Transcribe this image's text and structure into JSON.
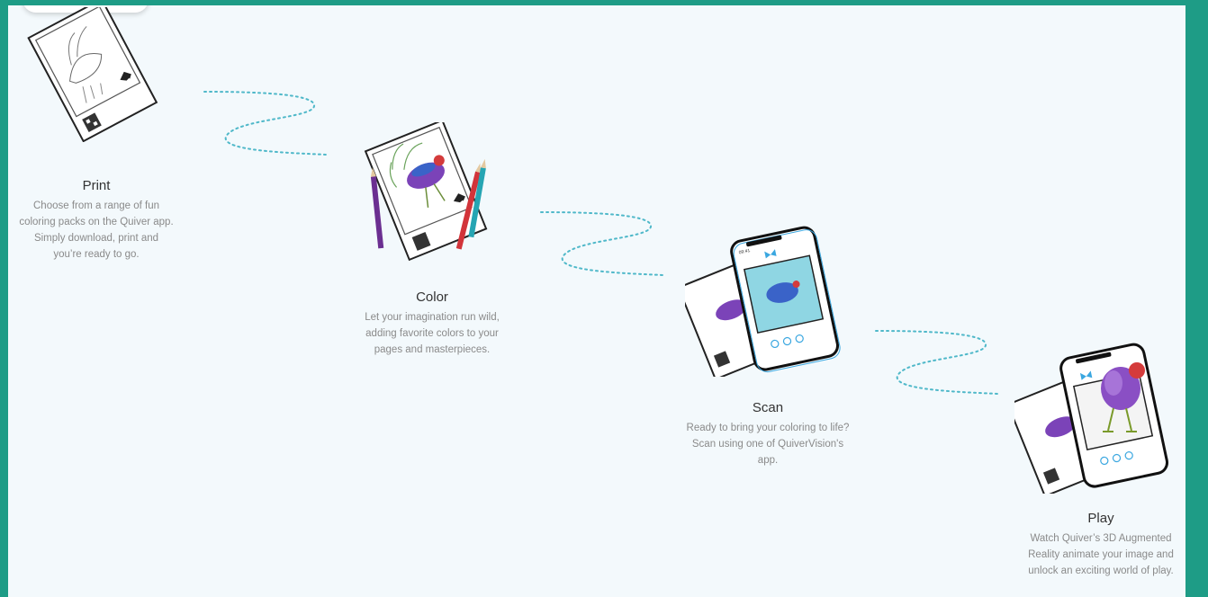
{
  "steps": [
    {
      "title": "Print",
      "description": "Choose from a range of fun coloring packs on the Quiver app. Simply download, print and you’re ready to go."
    },
    {
      "title": "Color",
      "description": "Let your imagination run wild, adding favorite colors to your pages and masterpieces."
    },
    {
      "title": "Scan",
      "description": "Ready to bring your coloring to life? Scan using one of QuiverVision's app."
    },
    {
      "title": "Play",
      "description": "Watch Quiver’s 3D Augmented Reality animate your image and unlock an exciting world of play."
    }
  ],
  "phone_status_time": "09:41",
  "colors": {
    "frame": "#1e9c86",
    "panel": "#f3f9fc",
    "dots": "#4fb8c9",
    "bird": "#7b43b8",
    "phone_blue": "#3aa7e0"
  }
}
